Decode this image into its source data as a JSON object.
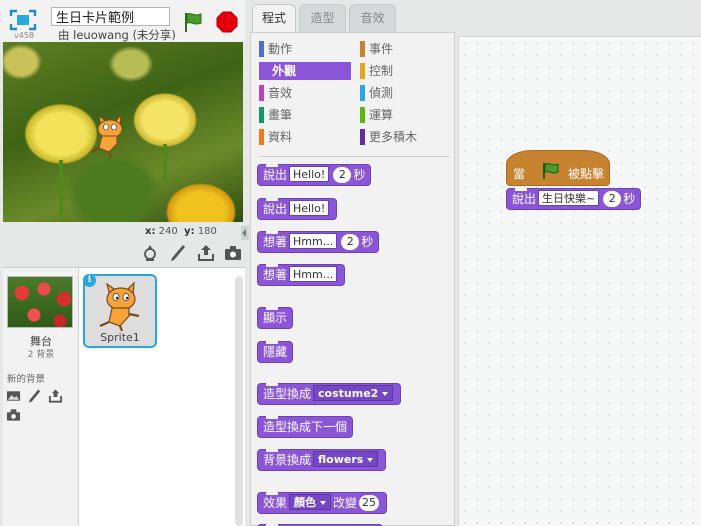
{
  "header": {
    "version": "v458",
    "project_title": "生日卡片範例",
    "owner_text": "由 leuowang (未分享)"
  },
  "stage": {
    "x_label": "x:",
    "x_value": "240",
    "y_label": "y:",
    "y_value": "180"
  },
  "sprites_panel": {
    "stage_name": "舞台",
    "stage_backdrops": "2 背景",
    "new_backdrop_label": "新的背景",
    "sprites": [
      {
        "name": "Sprite1",
        "selected": true
      }
    ]
  },
  "tabs": [
    {
      "label": "程式",
      "active": true
    },
    {
      "label": "造型",
      "active": false
    },
    {
      "label": "音效",
      "active": false
    }
  ],
  "categories": [
    {
      "label": "動作",
      "color": "#4a6cd4",
      "selected": false
    },
    {
      "label": "事件",
      "color": "#c88330",
      "selected": false
    },
    {
      "label": "外觀",
      "color": "#8a55d7",
      "selected": true
    },
    {
      "label": "控制",
      "color": "#e1a91a",
      "selected": false
    },
    {
      "label": "音效",
      "color": "#bb42c3",
      "selected": false
    },
    {
      "label": "偵測",
      "color": "#2ca5e2",
      "selected": false
    },
    {
      "label": "畫筆",
      "color": "#0e9a6c",
      "selected": false
    },
    {
      "label": "運算",
      "color": "#5cb712",
      "selected": false
    },
    {
      "label": "資料",
      "color": "#ee7d16",
      "selected": false
    },
    {
      "label": "更多積木",
      "color": "#632d99",
      "selected": false
    }
  ],
  "palette_blocks": {
    "say_for": {
      "label": "說出",
      "text": "Hello!",
      "secs": "2",
      "unit": "秒"
    },
    "say": {
      "label": "說出",
      "text": "Hello!"
    },
    "think_for": {
      "label": "想著",
      "text": "Hmm...",
      "secs": "2",
      "unit": "秒"
    },
    "think": {
      "label": "想著",
      "text": "Hmm..."
    },
    "show": {
      "label": "顯示"
    },
    "hide": {
      "label": "隱藏"
    },
    "switch_costume": {
      "label": "造型換成",
      "value": "costume2"
    },
    "next_costume": {
      "label": "造型換成下一個"
    },
    "switch_backdrop": {
      "label": "背景換成",
      "value": "flowers"
    },
    "change_effect": {
      "label": "效果",
      "effect": "顏色",
      "change": "改變",
      "amount": "25"
    }
  },
  "script": {
    "hat": {
      "prefix": "當",
      "suffix": "被點擊"
    },
    "say_for": {
      "label": "說出",
      "text": "生日快樂~",
      "secs": "2",
      "unit": "秒"
    }
  },
  "colors": {
    "looks": "#8a55d7",
    "events": "#c88330",
    "accent": "#29a8e0",
    "stop": "#e3000b",
    "flag": "#4c9a2a"
  }
}
